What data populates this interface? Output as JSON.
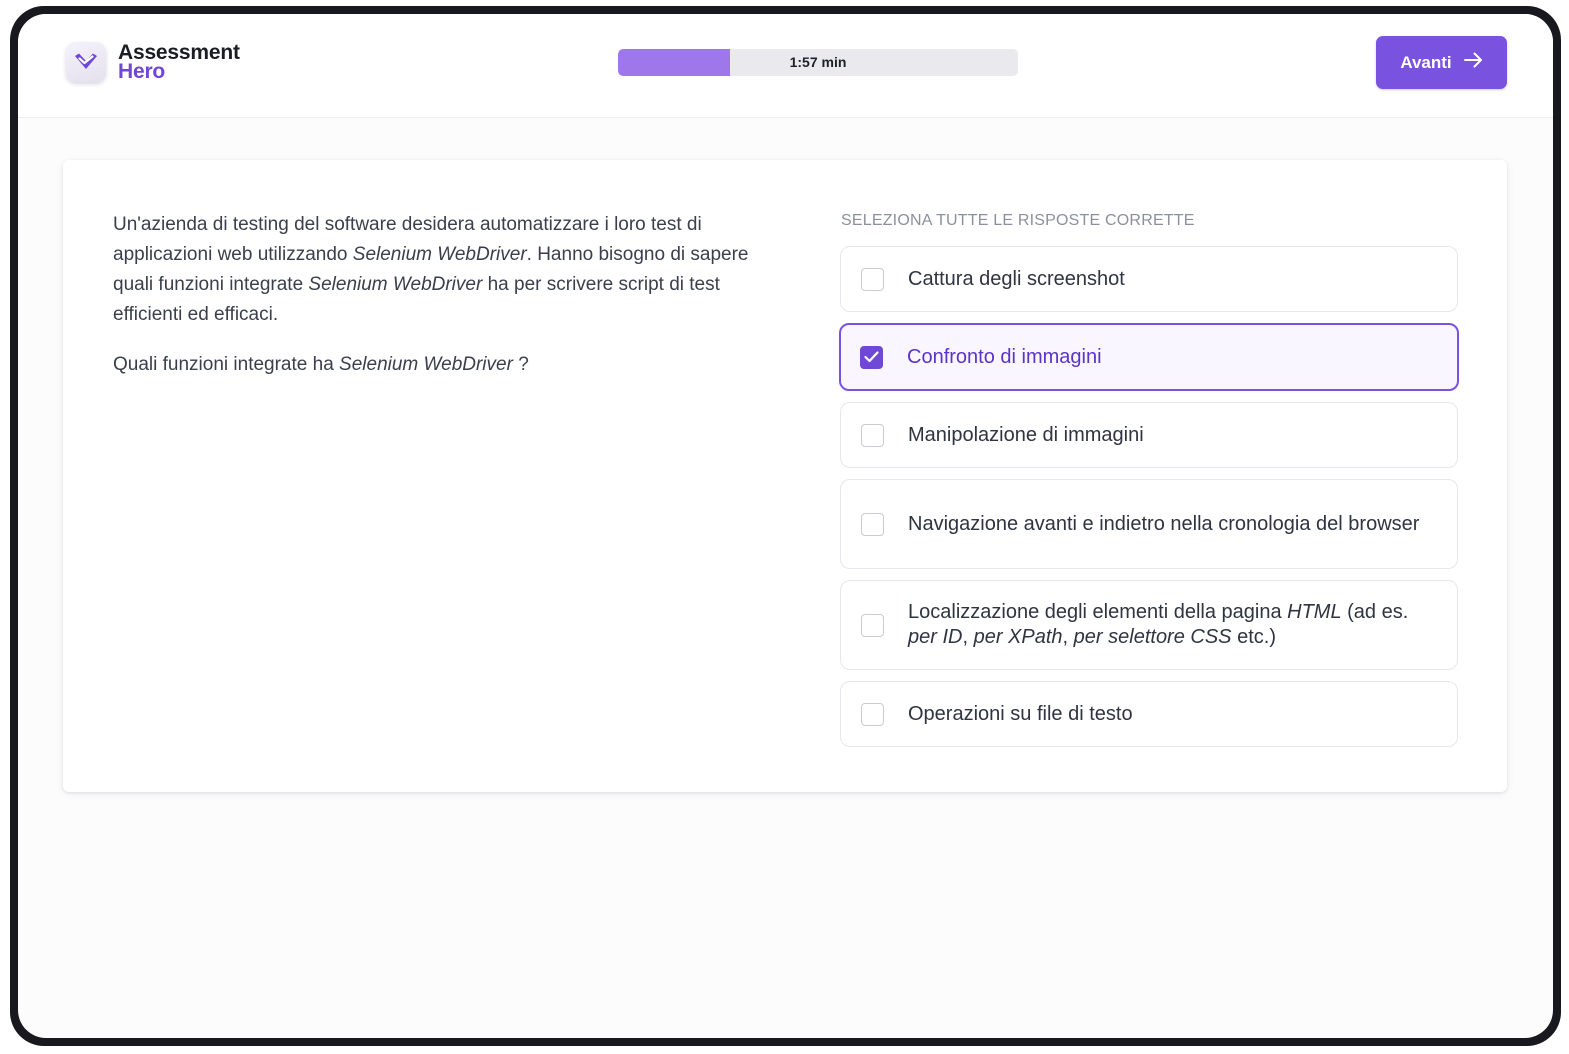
{
  "app": {
    "logo_line1": "Assessment",
    "logo_line2": "Hero",
    "logo_icon": "heart-check-icon"
  },
  "timer": {
    "label": "1:57 min",
    "progress_fraction": 0.28,
    "color": "#9e78ea"
  },
  "next_button": {
    "label": "Avanti",
    "icon": "arrow-right-icon",
    "color": "#7a52e0"
  },
  "question": {
    "p1_a": "Un'azienda di testing del software desidera automatizzare i loro test di applicazioni web utilizzando ",
    "p1_b": "Selenium WebDriver",
    "p1_c": ". Hanno bisogno di sapere quali funzioni integrate ",
    "p1_d": "Selenium WebDriver",
    "p1_e": " ha per scrivere script di test efficienti ed efficaci.",
    "p2_a": "Quali funzioni integrate ha ",
    "p2_b": "Selenium WebDriver",
    "p2_c": " ?"
  },
  "choices_header": "SELEZIONA TUTTE LE RISPOSTE CORRETTE",
  "choices": [
    {
      "label": "Cattura degli screenshot",
      "checked": false
    },
    {
      "label": "Confronto di immagini",
      "checked": true
    },
    {
      "label": "Manipolazione di immagini",
      "checked": false
    },
    {
      "label": "Navigazione avanti e indietro nella cronologia del browser",
      "checked": false
    },
    {
      "label_a": "Localizzazione degli elementi della pagina ",
      "label_b": "HTML",
      "label_c": " (ad es. ",
      "label_d": "per ID",
      "label_e": ", ",
      "label_f": "per XPath",
      "label_g": ", ",
      "label_h": "per selettore CSS",
      "label_i": " etc.)",
      "checked": false
    },
    {
      "label": "Operazioni su file di testo",
      "checked": false
    }
  ],
  "accent_color": "#6f48d8"
}
